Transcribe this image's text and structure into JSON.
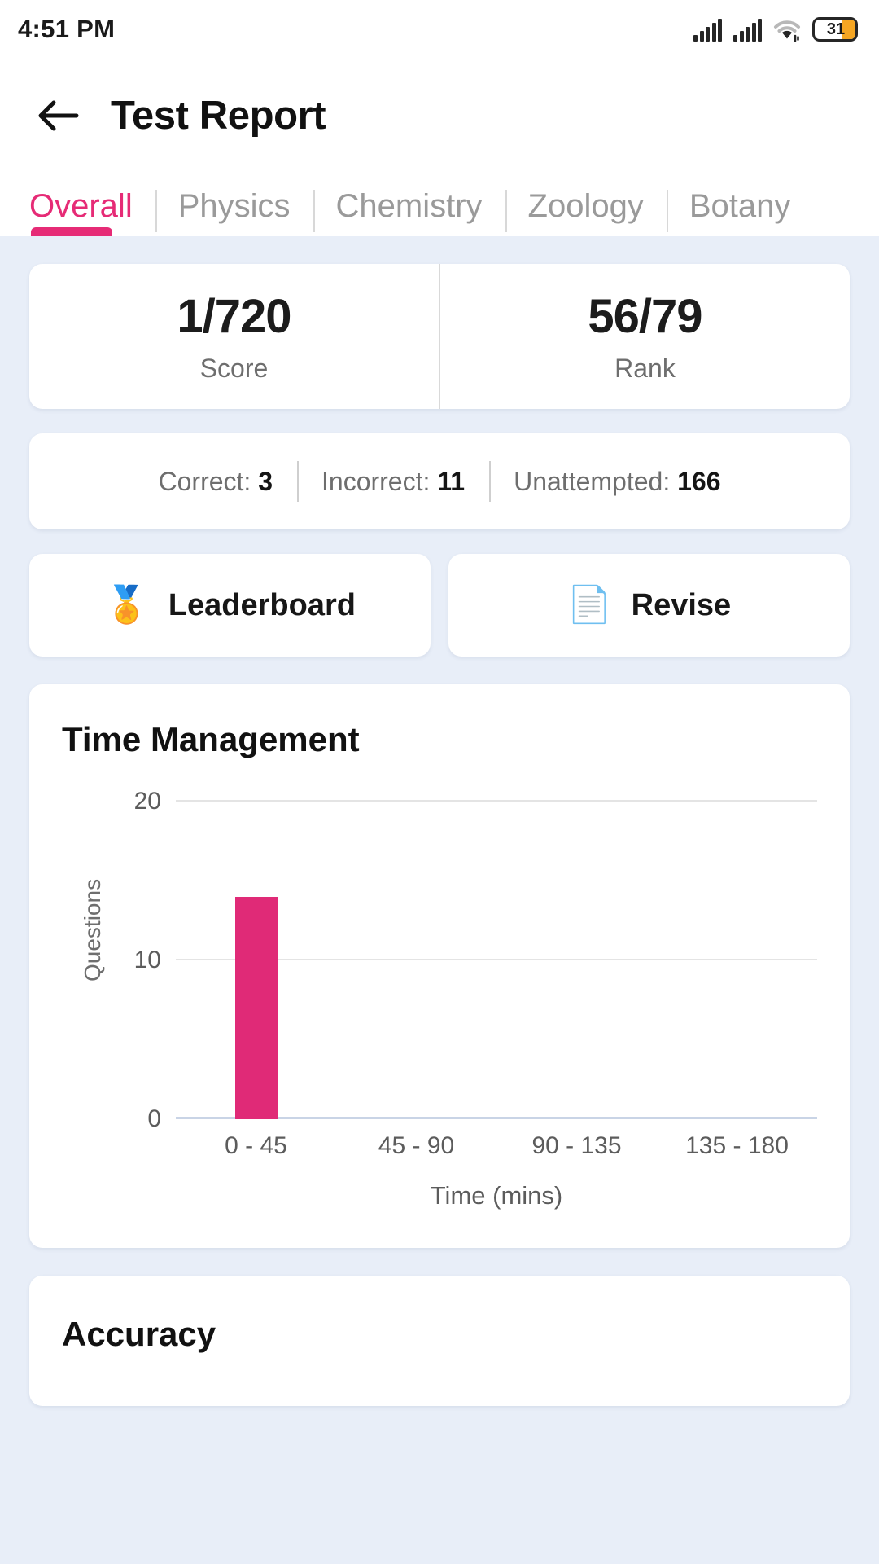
{
  "status_bar": {
    "time": "4:51 PM",
    "battery_percent": "31",
    "signal_icon": "signal-bars-icon",
    "wifi_icon": "wifi-icon",
    "battery_icon": "battery-icon"
  },
  "app_bar": {
    "back_icon": "back-arrow-icon",
    "title": "Test Report"
  },
  "tabs": {
    "items": [
      {
        "label": "Overall",
        "active": true
      },
      {
        "label": "Physics",
        "active": false
      },
      {
        "label": "Chemistry",
        "active": false
      },
      {
        "label": "Zoology",
        "active": false
      },
      {
        "label": "Botany",
        "active": false
      }
    ],
    "active_color": "#e62b76",
    "inactive_color": "#9a9a9a"
  },
  "score_card": {
    "score_value": "1/720",
    "score_label": "Score",
    "rank_value": "56/79",
    "rank_label": "Rank"
  },
  "stats_card": {
    "correct_label": "Correct:",
    "correct_value": "3",
    "incorrect_label": "Incorrect:",
    "incorrect_value": "11",
    "unattempted_label": "Unattempted:",
    "unattempted_value": "166"
  },
  "actions": {
    "leaderboard_icon": "medal-icon",
    "leaderboard_glyph": "🏅",
    "leaderboard_label": "Leaderboard",
    "revise_icon": "document-icon",
    "revise_glyph": "📄",
    "revise_label": "Revise"
  },
  "time_management": {
    "title": "Time Management"
  },
  "accuracy": {
    "title": "Accuracy"
  },
  "chart_data": {
    "type": "bar",
    "title": "Time Management",
    "categories": [
      "0 - 45",
      "45 - 90",
      "90 - 135",
      "135 - 180"
    ],
    "values": [
      14,
      0,
      0,
      0
    ],
    "xlabel": "Time (mins)",
    "ylabel": "Questions",
    "ylim": [
      0,
      20
    ],
    "yticks": [
      0,
      10,
      20
    ],
    "grid": true,
    "legend": "none",
    "bar_color": "#e02a77"
  }
}
